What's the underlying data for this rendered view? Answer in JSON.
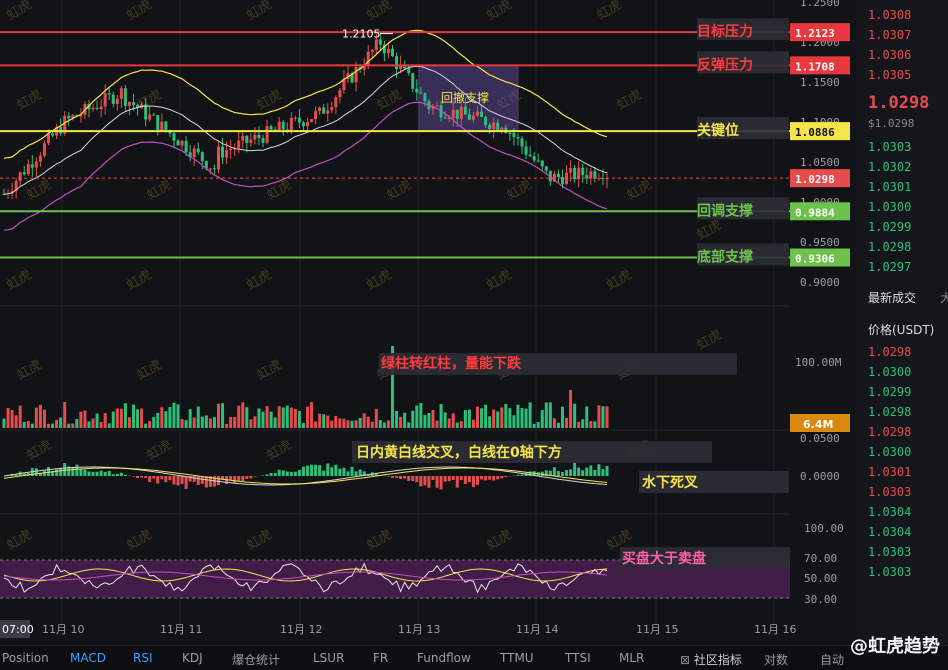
{
  "price_levels": [
    {
      "label": "目标压力",
      "value": "1.2123",
      "price": 1.2123,
      "color": "#e8373d",
      "text_color": "#ff3b3b"
    },
    {
      "label": "反弹压力",
      "value": "1.1708",
      "price": 1.1708,
      "color": "#e8373d",
      "text_color": "#ff3b3b"
    },
    {
      "label": "关键位",
      "value": "1.0886",
      "price": 1.0886,
      "color": "#f5e54a",
      "text_color": "#f5e54a"
    },
    {
      "label": "回调支撑",
      "value": "0.9884",
      "price": 0.9884,
      "color": "#6cc24a",
      "text_color": "#6cc24a"
    },
    {
      "label": "底部支撑",
      "value": "0.9306",
      "price": 0.9306,
      "color": "#6cc24a",
      "text_color": "#6cc24a"
    }
  ],
  "current_price": {
    "value": "1.0298",
    "price": 1.0298
  },
  "peak_label": "1.2105",
  "retrace_box_label": "回撤支撑",
  "price_axis": [
    "1.2500",
    "1.2000",
    "1.1500",
    "1.1000",
    "1.0500",
    "1.0000",
    "0.9500",
    "0.9000"
  ],
  "volume_axis": [
    "100.00M"
  ],
  "volume_tag": "6.4M",
  "macd_axis": [
    "0.0500",
    "0.0000"
  ],
  "rsi_axis": [
    "100.00",
    "70.00",
    "50.00",
    "30.00"
  ],
  "annotations": {
    "volume": "绿柱转红柱，量能下跌",
    "macd": "日内黄白线交叉，白线在0轴下方",
    "macd_death": "水下死叉",
    "rsi": "买盘大于卖盘"
  },
  "x_axis": {
    "first": "07:00",
    "dates": [
      "11月 10",
      "11月 11",
      "11月 12",
      "11月 13",
      "11月 14",
      "11月 15",
      "11月 16"
    ]
  },
  "watermark": "虹虎",
  "side_panel": {
    "top_prices": [
      "1.0308",
      "1.0307",
      "1.0306",
      "1.0305"
    ],
    "last_price": "1.0298",
    "last_price_usd": "$1.0298",
    "book_prices": [
      "1.0303",
      "1.0302",
      "1.0301",
      "1.0300",
      "1.0299",
      "1.0298",
      "1.0297"
    ],
    "trades_title": "最新成交",
    "trades_extra": "大",
    "price_header": "价格(USDT)",
    "trades": [
      {
        "p": "1.0298",
        "c": "#e74c4c"
      },
      {
        "p": "1.0300",
        "c": "#2bbf7a"
      },
      {
        "p": "1.0299",
        "c": "#2bbf7a"
      },
      {
        "p": "1.0298",
        "c": "#2bbf7a"
      },
      {
        "p": "1.0298",
        "c": "#e74c4c"
      },
      {
        "p": "1.0300",
        "c": "#2bbf7a"
      },
      {
        "p": "1.0301",
        "c": "#e74c4c"
      },
      {
        "p": "1.0303",
        "c": "#e74c4c"
      },
      {
        "p": "1.0304",
        "c": "#2bbf7a"
      },
      {
        "p": "1.0304",
        "c": "#2bbf7a"
      },
      {
        "p": "1.0303",
        "c": "#2bbf7a"
      },
      {
        "p": "1.0303",
        "c": "#2bbf7a"
      }
    ]
  },
  "bottom_tabs": [
    {
      "label": "Position",
      "active": false
    },
    {
      "label": "MACD",
      "active": true
    },
    {
      "label": "RSI",
      "active": true
    },
    {
      "label": "KDJ",
      "active": false
    },
    {
      "label": "爆仓统计",
      "active": false
    },
    {
      "label": "LSUR",
      "active": false
    },
    {
      "label": "FR",
      "active": false
    },
    {
      "label": "Fundflow",
      "active": false
    },
    {
      "label": "TTMU",
      "active": false
    },
    {
      "label": "TTSI",
      "active": false
    },
    {
      "label": "MLR",
      "active": false
    }
  ],
  "bottom_right": {
    "community": "社区指标",
    "pair": "对数",
    "auto": "自动"
  },
  "brand": "@虹虎趋势",
  "colors": {
    "up": "#e74c4c",
    "down": "#2bbf7a",
    "ma_yellow": "#f5e54a",
    "ma_white": "#d6d6d6",
    "ma_purple": "#c24fc2",
    "rsi_band": "#4a1f4f"
  }
}
